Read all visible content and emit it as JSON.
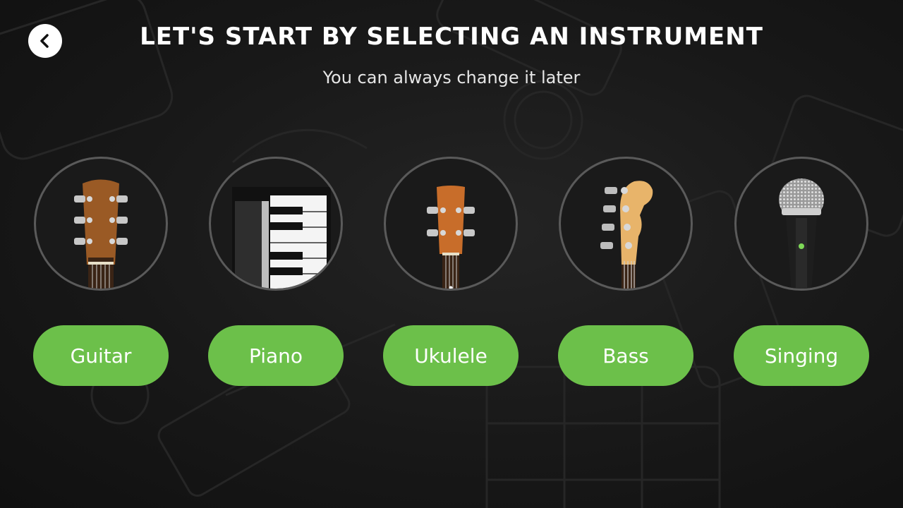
{
  "header": {
    "title": "LET'S START BY SELECTING AN INSTRUMENT",
    "subtitle": "You can always change it later",
    "back_icon": "chevron-left-icon"
  },
  "instruments": [
    {
      "label": "Guitar",
      "icon": "guitar-headstock-icon"
    },
    {
      "label": "Piano",
      "icon": "piano-keys-icon"
    },
    {
      "label": "Ukulele",
      "icon": "ukulele-headstock-icon"
    },
    {
      "label": "Bass",
      "icon": "bass-headstock-icon"
    },
    {
      "label": "Singing",
      "icon": "microphone-icon"
    }
  ],
  "colors": {
    "background": "#141414",
    "button": "#6cc04a",
    "circle_border": "#5a5a5a",
    "text": "#ffffff"
  }
}
